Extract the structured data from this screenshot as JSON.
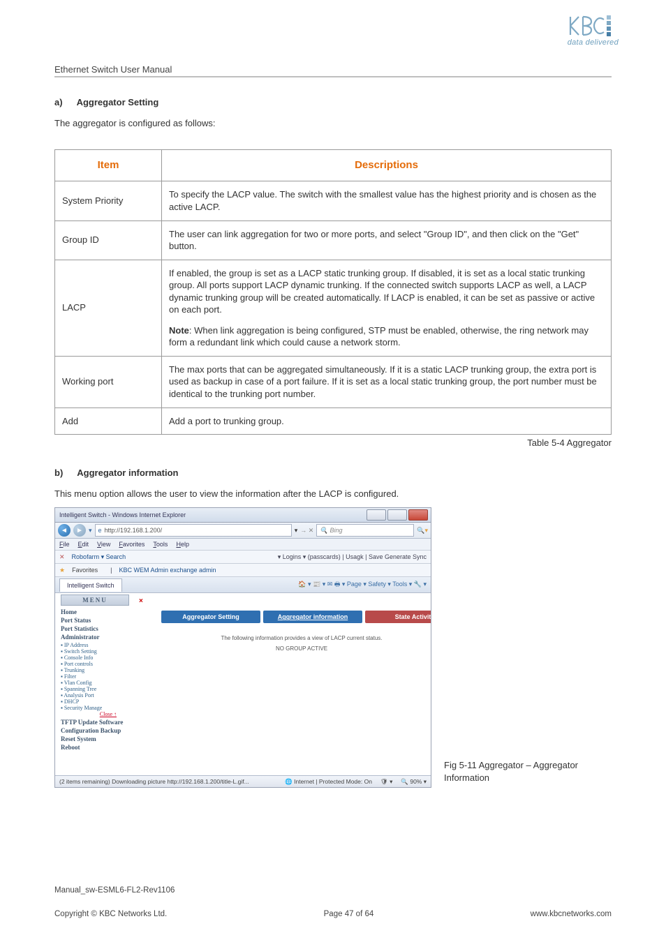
{
  "logo_tagline": "data delivered",
  "header_title": "Ethernet Switch User Manual",
  "section_a_letter": "a)",
  "section_a_title": "Aggregator Setting",
  "intro_a": "The aggregator is configured as follows:",
  "table": {
    "head_item": "Item",
    "head_desc": "Descriptions",
    "rows": [
      {
        "item": "System Priority",
        "desc": [
          "To specify the LACP value. The switch with the smallest value has the highest priority and is chosen as the active LACP."
        ]
      },
      {
        "item": "Group ID",
        "desc": [
          "The user can link aggregation for two or more ports, and select \"Group ID\", and then click on the \"Get\" button."
        ]
      },
      {
        "item": "LACP",
        "desc": [
          "If enabled, the group is set as a LACP static trunking group. If disabled, it is set as a local static trunking group. All ports support LACP dynamic trunking. If the connected switch supports LACP as well, a LACP dynamic trunking group will be created automatically. If LACP is enabled, it can be set as passive or active on each port.",
          "<b>Note</b>: When link aggregation is being configured, STP must be enabled, otherwise, the ring network may form a redundant link which could cause a network storm."
        ]
      },
      {
        "item": "Working port",
        "desc": [
          "The max ports that can be aggregated simultaneously. If it is a static LACP trunking group, the extra port is used as backup in case of a port failure. If it is set as a local static trunking group, the port number must be identical to the trunking port number."
        ]
      },
      {
        "item": "Add",
        "desc": [
          "Add a port to trunking group."
        ]
      }
    ],
    "caption": "Table 5-4 Aggregator"
  },
  "section_b_letter": "b)",
  "section_b_title": "Aggregator information",
  "intro_b": "This menu option allows the user to view the information after the LACP is configured.",
  "screenshot": {
    "window_title": "Intelligent Switch - Windows Internet Explorer",
    "url": "http://192.168.1.200/",
    "search_placeholder": "Bing",
    "menus": [
      "File",
      "Edit",
      "View",
      "Favorites",
      "Tools",
      "Help"
    ],
    "toolbar_search": "Robofarm ▾ Search",
    "toolbar_items": "▾ Logins ▾ (passcards)  |  Usagk  |  Save  Generate  Sync",
    "fav_label": "Favorites",
    "fav_items": "KBC WEM Admin   exchange admin",
    "tab_title": "Intelligent Switch",
    "tab_icons": "🏠 ▾  📰 ▾  ✉  🖶 ▾  Page ▾  Safety ▾  Tools ▾  🔧 ▾",
    "menu_label": "MENU",
    "sidebar": {
      "cats_top": [
        "Home",
        "Port Status",
        "Port Statistics",
        "Administrator"
      ],
      "admin_subs": [
        "IP Address",
        "Switch Setting",
        "Console Info",
        "Port controls",
        "Trunking",
        "Filter",
        "Vlan Config",
        "Spanning Tree",
        "Analysis Port",
        "DHCP",
        "Security Manage"
      ],
      "close": "Close ↑",
      "cats_bottom": [
        "TFTP Update Software",
        "Configuration Backup",
        "Reset System",
        "Reboot"
      ]
    },
    "close_mark": "×",
    "agg_tabs": [
      "Aggregator Setting",
      "Aggregator information",
      "State Activity"
    ],
    "agg_msg1": "The following information provides a view of LACP current status.",
    "agg_msg2": "NO GROUP ACTIVE",
    "status_left": "(2 items remaining) Downloading picture http://192.168.1.200/title-L.gif...",
    "status_mid": "Internet | Protected Mode: On",
    "status_zoom": "90%"
  },
  "fig_caption": "Fig 5-11 Aggregator – Aggregator Information",
  "footer": {
    "manual": "Manual_sw-ESML6-FL2-Rev1106",
    "copyright": "Copyright © KBC Networks Ltd.",
    "page": "Page 47 of 64",
    "url": "www.kbcnetworks.com"
  }
}
